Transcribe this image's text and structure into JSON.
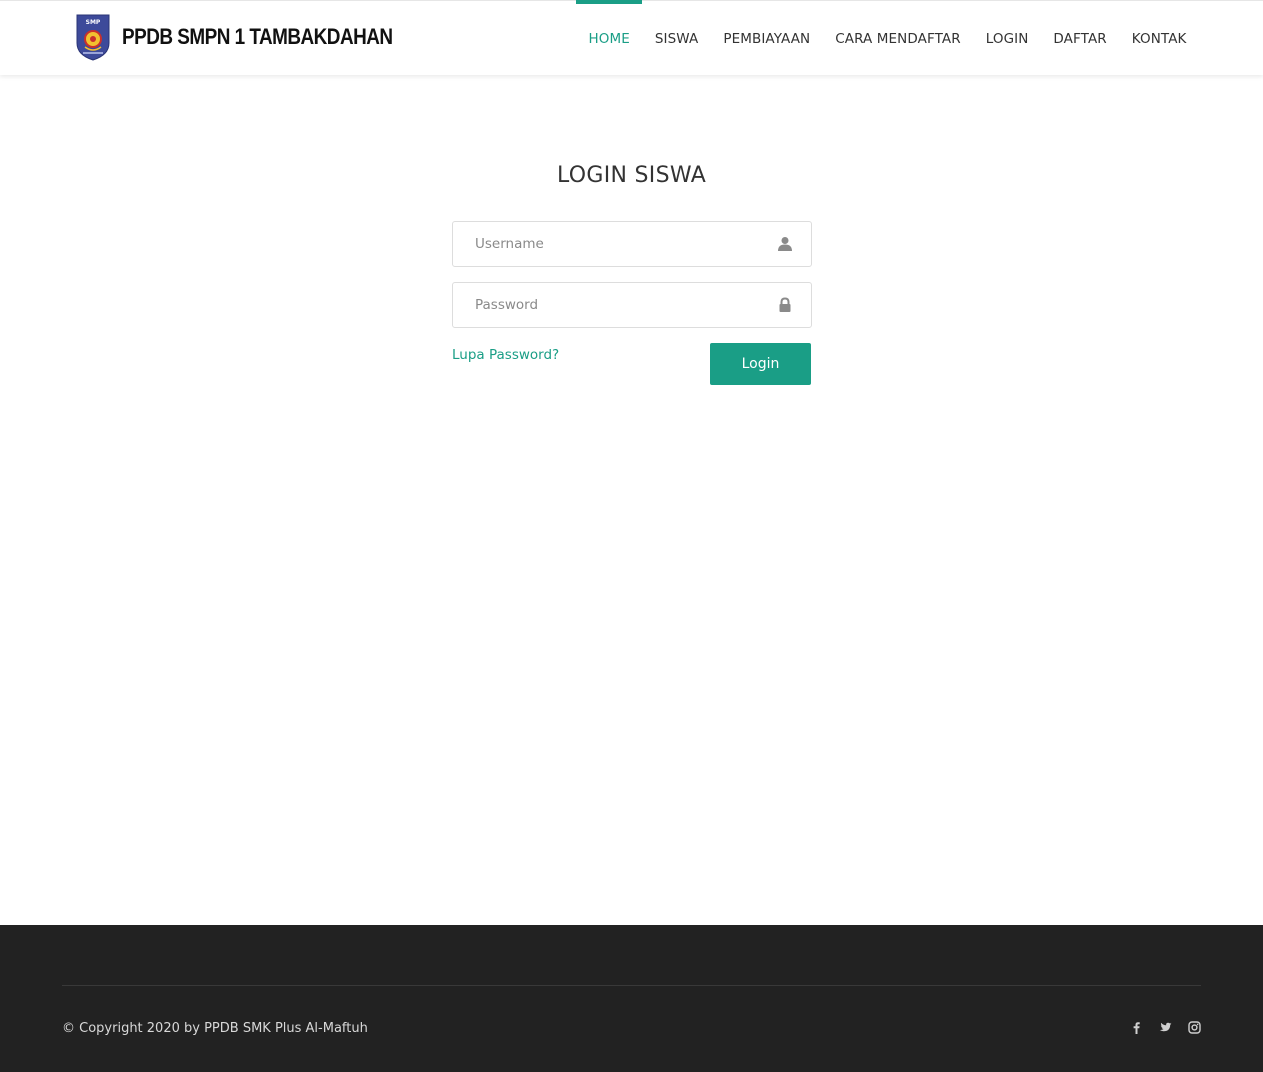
{
  "header": {
    "brand": "PPDB SMPN 1 TAMBAKDAHAN",
    "logo_text": "SMP",
    "nav": [
      {
        "label": "HOME",
        "active": true
      },
      {
        "label": "SISWA",
        "active": false
      },
      {
        "label": "PEMBIAYAAN",
        "active": false
      },
      {
        "label": "CARA MENDAFTAR",
        "active": false
      },
      {
        "label": "LOGIN",
        "active": false
      },
      {
        "label": "DAFTAR",
        "active": false
      },
      {
        "label": "KONTAK",
        "active": false
      }
    ]
  },
  "login": {
    "title": "LOGIN SISWA",
    "username": {
      "value": "",
      "placeholder": "Username",
      "icon": "user-icon"
    },
    "password": {
      "value": "",
      "placeholder": "Password",
      "icon": "lock-icon"
    },
    "forgot_label": "Lupa Password?",
    "button_label": "Login"
  },
  "footer": {
    "copyright": "© Copyright 2020 by PPDB SMK Plus Al-Maftuh",
    "social": [
      "facebook-icon",
      "twitter-icon",
      "instagram-icon"
    ]
  },
  "colors": {
    "accent": "#1a9e86",
    "footer_bg": "#222222",
    "text": "#333333"
  }
}
